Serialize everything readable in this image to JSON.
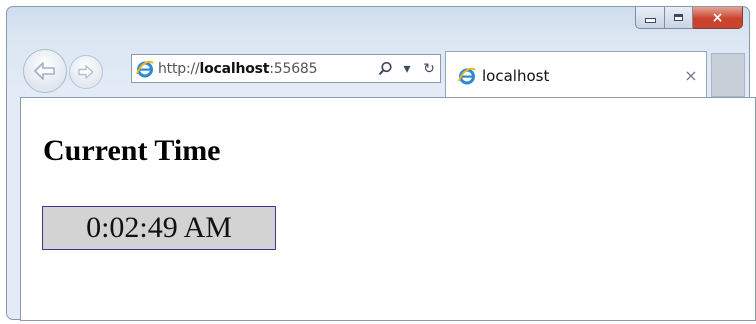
{
  "window": {
    "caption_buttons": {
      "minimize": "minimize-icon",
      "maximize": "maximize-icon",
      "close": "×"
    }
  },
  "toolbar": {
    "back_icon": "back-arrow-icon",
    "forward_icon": "forward-arrow-icon",
    "address": {
      "prefix": "http://",
      "host": "localhost",
      "suffix": ":55685",
      "search_icon": "search-icon",
      "dropdown_icon": "▾",
      "refresh_icon": "↻"
    }
  },
  "tab": {
    "label": "localhost",
    "close": "×"
  },
  "page": {
    "title": "Current Time",
    "time": "0:02:49 AM"
  },
  "colors": {
    "time_box_bg": "#d3d3d3",
    "time_box_border": "#3a3a8c",
    "close_button": "#c9432e"
  }
}
